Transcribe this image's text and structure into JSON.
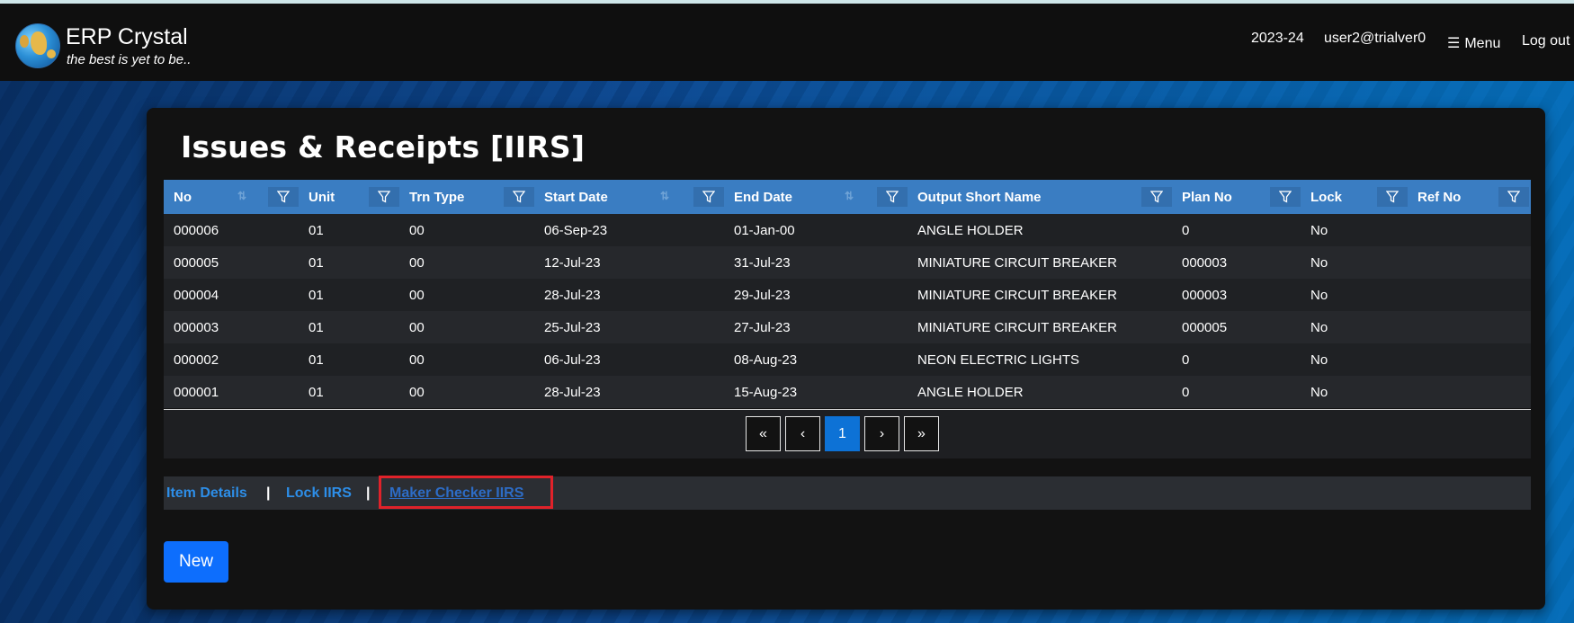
{
  "app": {
    "title": "ERP Crystal",
    "tagline": "the best is yet to be.."
  },
  "nav": {
    "year": "2023-24",
    "user": "user2@trialver0",
    "menu_label": "Menu",
    "logout_label": "Log out"
  },
  "page": {
    "title": "Issues & Receipts [IIRS]"
  },
  "grid": {
    "columns": [
      {
        "label": "No",
        "sortable": true
      },
      {
        "label": "Unit",
        "sortable": false
      },
      {
        "label": "Trn Type",
        "sortable": false
      },
      {
        "label": "Start Date",
        "sortable": true
      },
      {
        "label": "End Date",
        "sortable": true
      },
      {
        "label": "Output Short Name",
        "sortable": false
      },
      {
        "label": "Plan No",
        "sortable": false
      },
      {
        "label": "Lock",
        "sortable": false
      },
      {
        "label": "Ref No",
        "sortable": false
      }
    ],
    "rows": [
      [
        "000006",
        "01",
        "00",
        "06-Sep-23",
        "01-Jan-00",
        "ANGLE HOLDER",
        "0",
        "No",
        ""
      ],
      [
        "000005",
        "01",
        "00",
        "12-Jul-23",
        "31-Jul-23",
        "MINIATURE CIRCUIT BREAKER",
        "000003",
        "No",
        ""
      ],
      [
        "000004",
        "01",
        "00",
        "28-Jul-23",
        "29-Jul-23",
        "MINIATURE CIRCUIT BREAKER",
        "000003",
        "No",
        ""
      ],
      [
        "000003",
        "01",
        "00",
        "25-Jul-23",
        "27-Jul-23",
        "MINIATURE CIRCUIT BREAKER",
        "000005",
        "No",
        ""
      ],
      [
        "000002",
        "01",
        "00",
        "06-Jul-23",
        "08-Aug-23",
        "NEON ELECTRIC LIGHTS",
        "0",
        "No",
        ""
      ],
      [
        "000001",
        "01",
        "00",
        "28-Jul-23",
        "15-Aug-23",
        "ANGLE HOLDER",
        "0",
        "No",
        ""
      ]
    ]
  },
  "pager": {
    "first": "«",
    "prev": "‹",
    "current": "1",
    "next": "›",
    "last": "»"
  },
  "links": {
    "item_details": "Item Details",
    "lock": "Lock IIRS",
    "maker_checker": "Maker Checker IIRS",
    "separator": "|"
  },
  "actions": {
    "new_label": "New"
  },
  "colors": {
    "header_blue": "#3a7dc2",
    "active_page": "#0d72d6",
    "new_button": "#0d6efd",
    "highlight_box": "#e0222a"
  }
}
